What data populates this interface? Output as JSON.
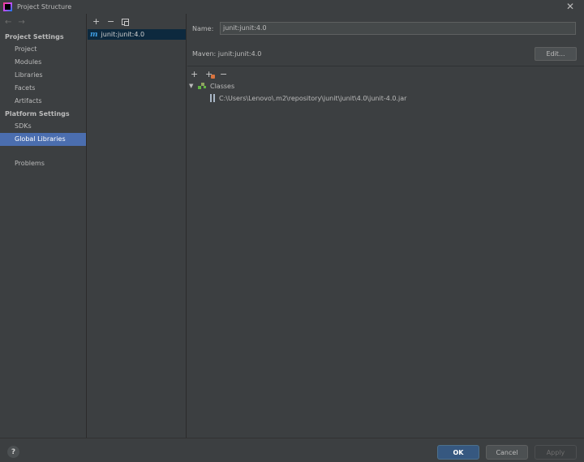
{
  "window": {
    "title": "Project Structure"
  },
  "sidebar": {
    "project_settings_header": "Project Settings",
    "project_items": [
      "Project",
      "Modules",
      "Libraries",
      "Facets",
      "Artifacts"
    ],
    "platform_settings_header": "Platform Settings",
    "platform_items": [
      "SDKs",
      "Global Libraries"
    ],
    "selected_item": "Global Libraries",
    "extra_items": [
      "Problems"
    ]
  },
  "library_list": {
    "items": [
      {
        "label": "junit:junit:4.0",
        "icon": "maven-icon",
        "selected": true
      }
    ]
  },
  "details": {
    "name_label": "Name:",
    "name_value": "junit:junit:4.0",
    "maven_text": "Maven: junit:junit:4.0",
    "edit_button": "Edit...",
    "tree": {
      "root_label": "Classes",
      "child_path": "C:\\Users\\Lenovo\\.m2\\repository\\junit\\junit\\4.0\\junit-4.0.jar"
    }
  },
  "footer": {
    "help": "?",
    "ok": "OK",
    "cancel": "Cancel",
    "apply": "Apply"
  },
  "colors": {
    "selection": "#4b6eaf",
    "ok_button": "#365880",
    "background": "#3c3f41"
  }
}
